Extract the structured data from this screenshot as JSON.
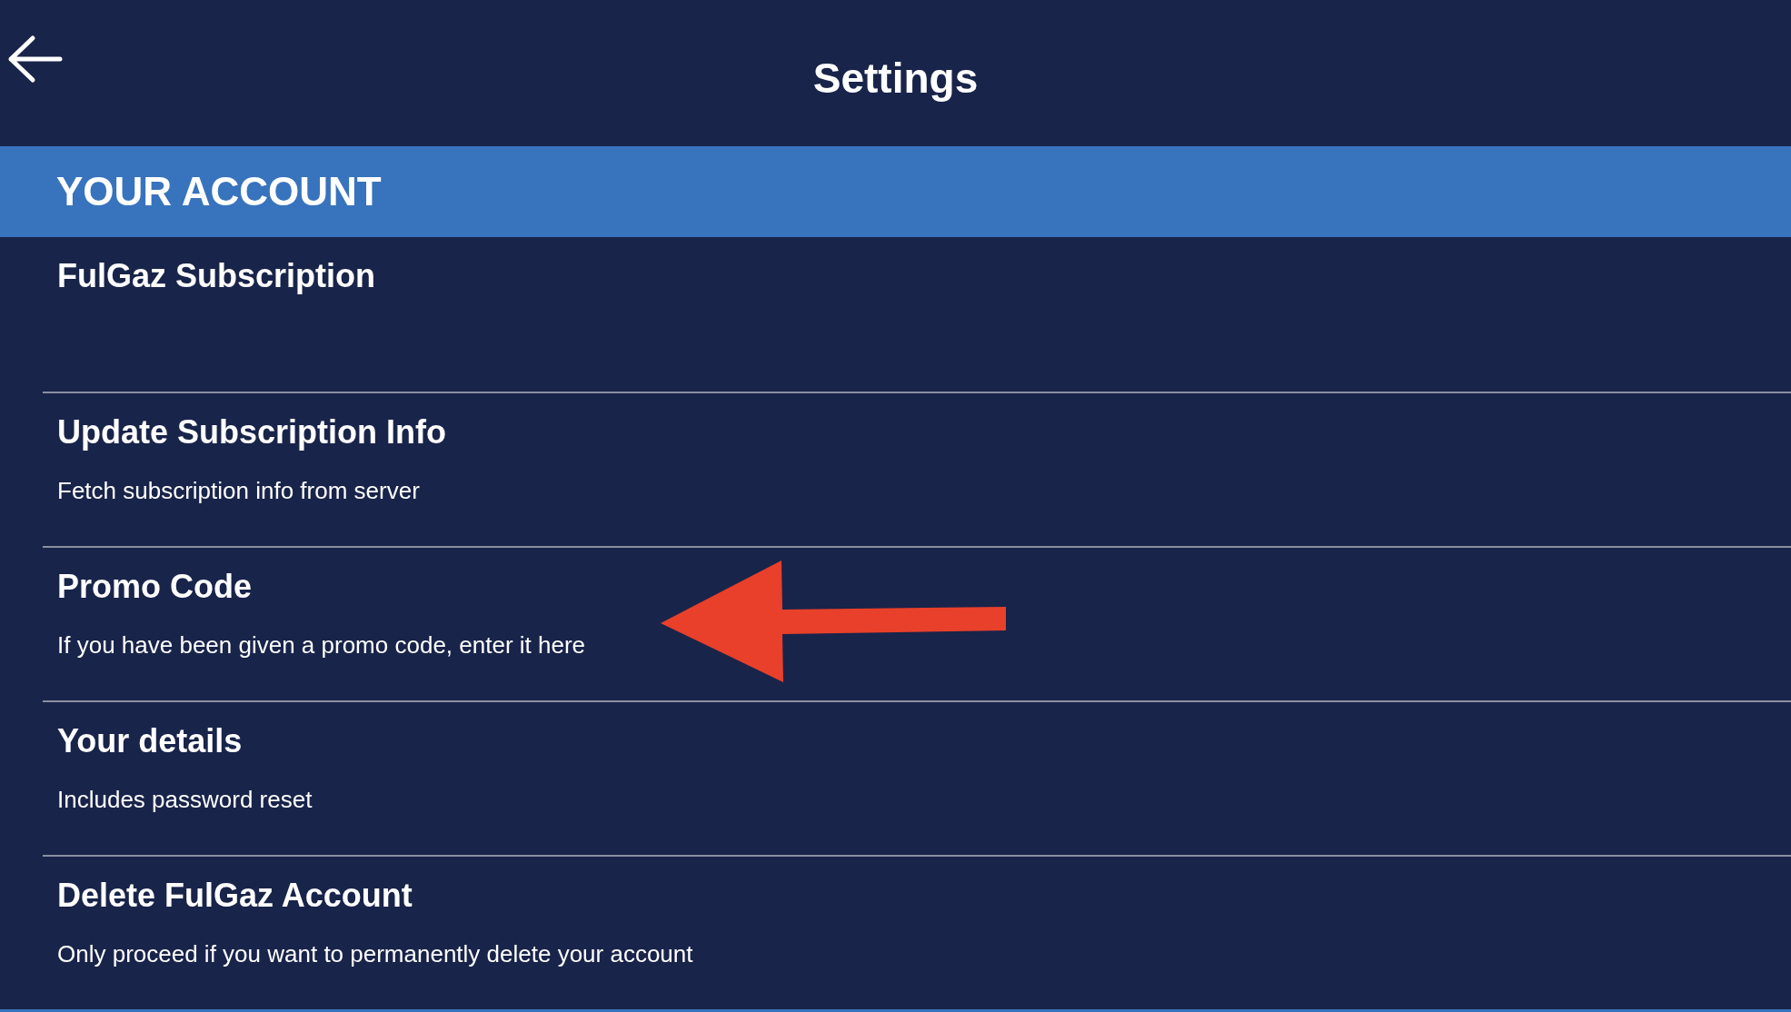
{
  "header": {
    "title": "Settings"
  },
  "section": {
    "title": "YOUR ACCOUNT"
  },
  "items": [
    {
      "title": "FulGaz Subscription"
    },
    {
      "title": "Update Subscription Info",
      "subtitle": "Fetch subscription info from server"
    },
    {
      "title": "Promo Code",
      "subtitle": "If you have been given a promo code, enter it here"
    },
    {
      "title": "Your details",
      "subtitle": "Includes password reset"
    },
    {
      "title": "Delete FulGaz Account",
      "subtitle": "Only proceed if you want to permanently delete your account"
    }
  ]
}
